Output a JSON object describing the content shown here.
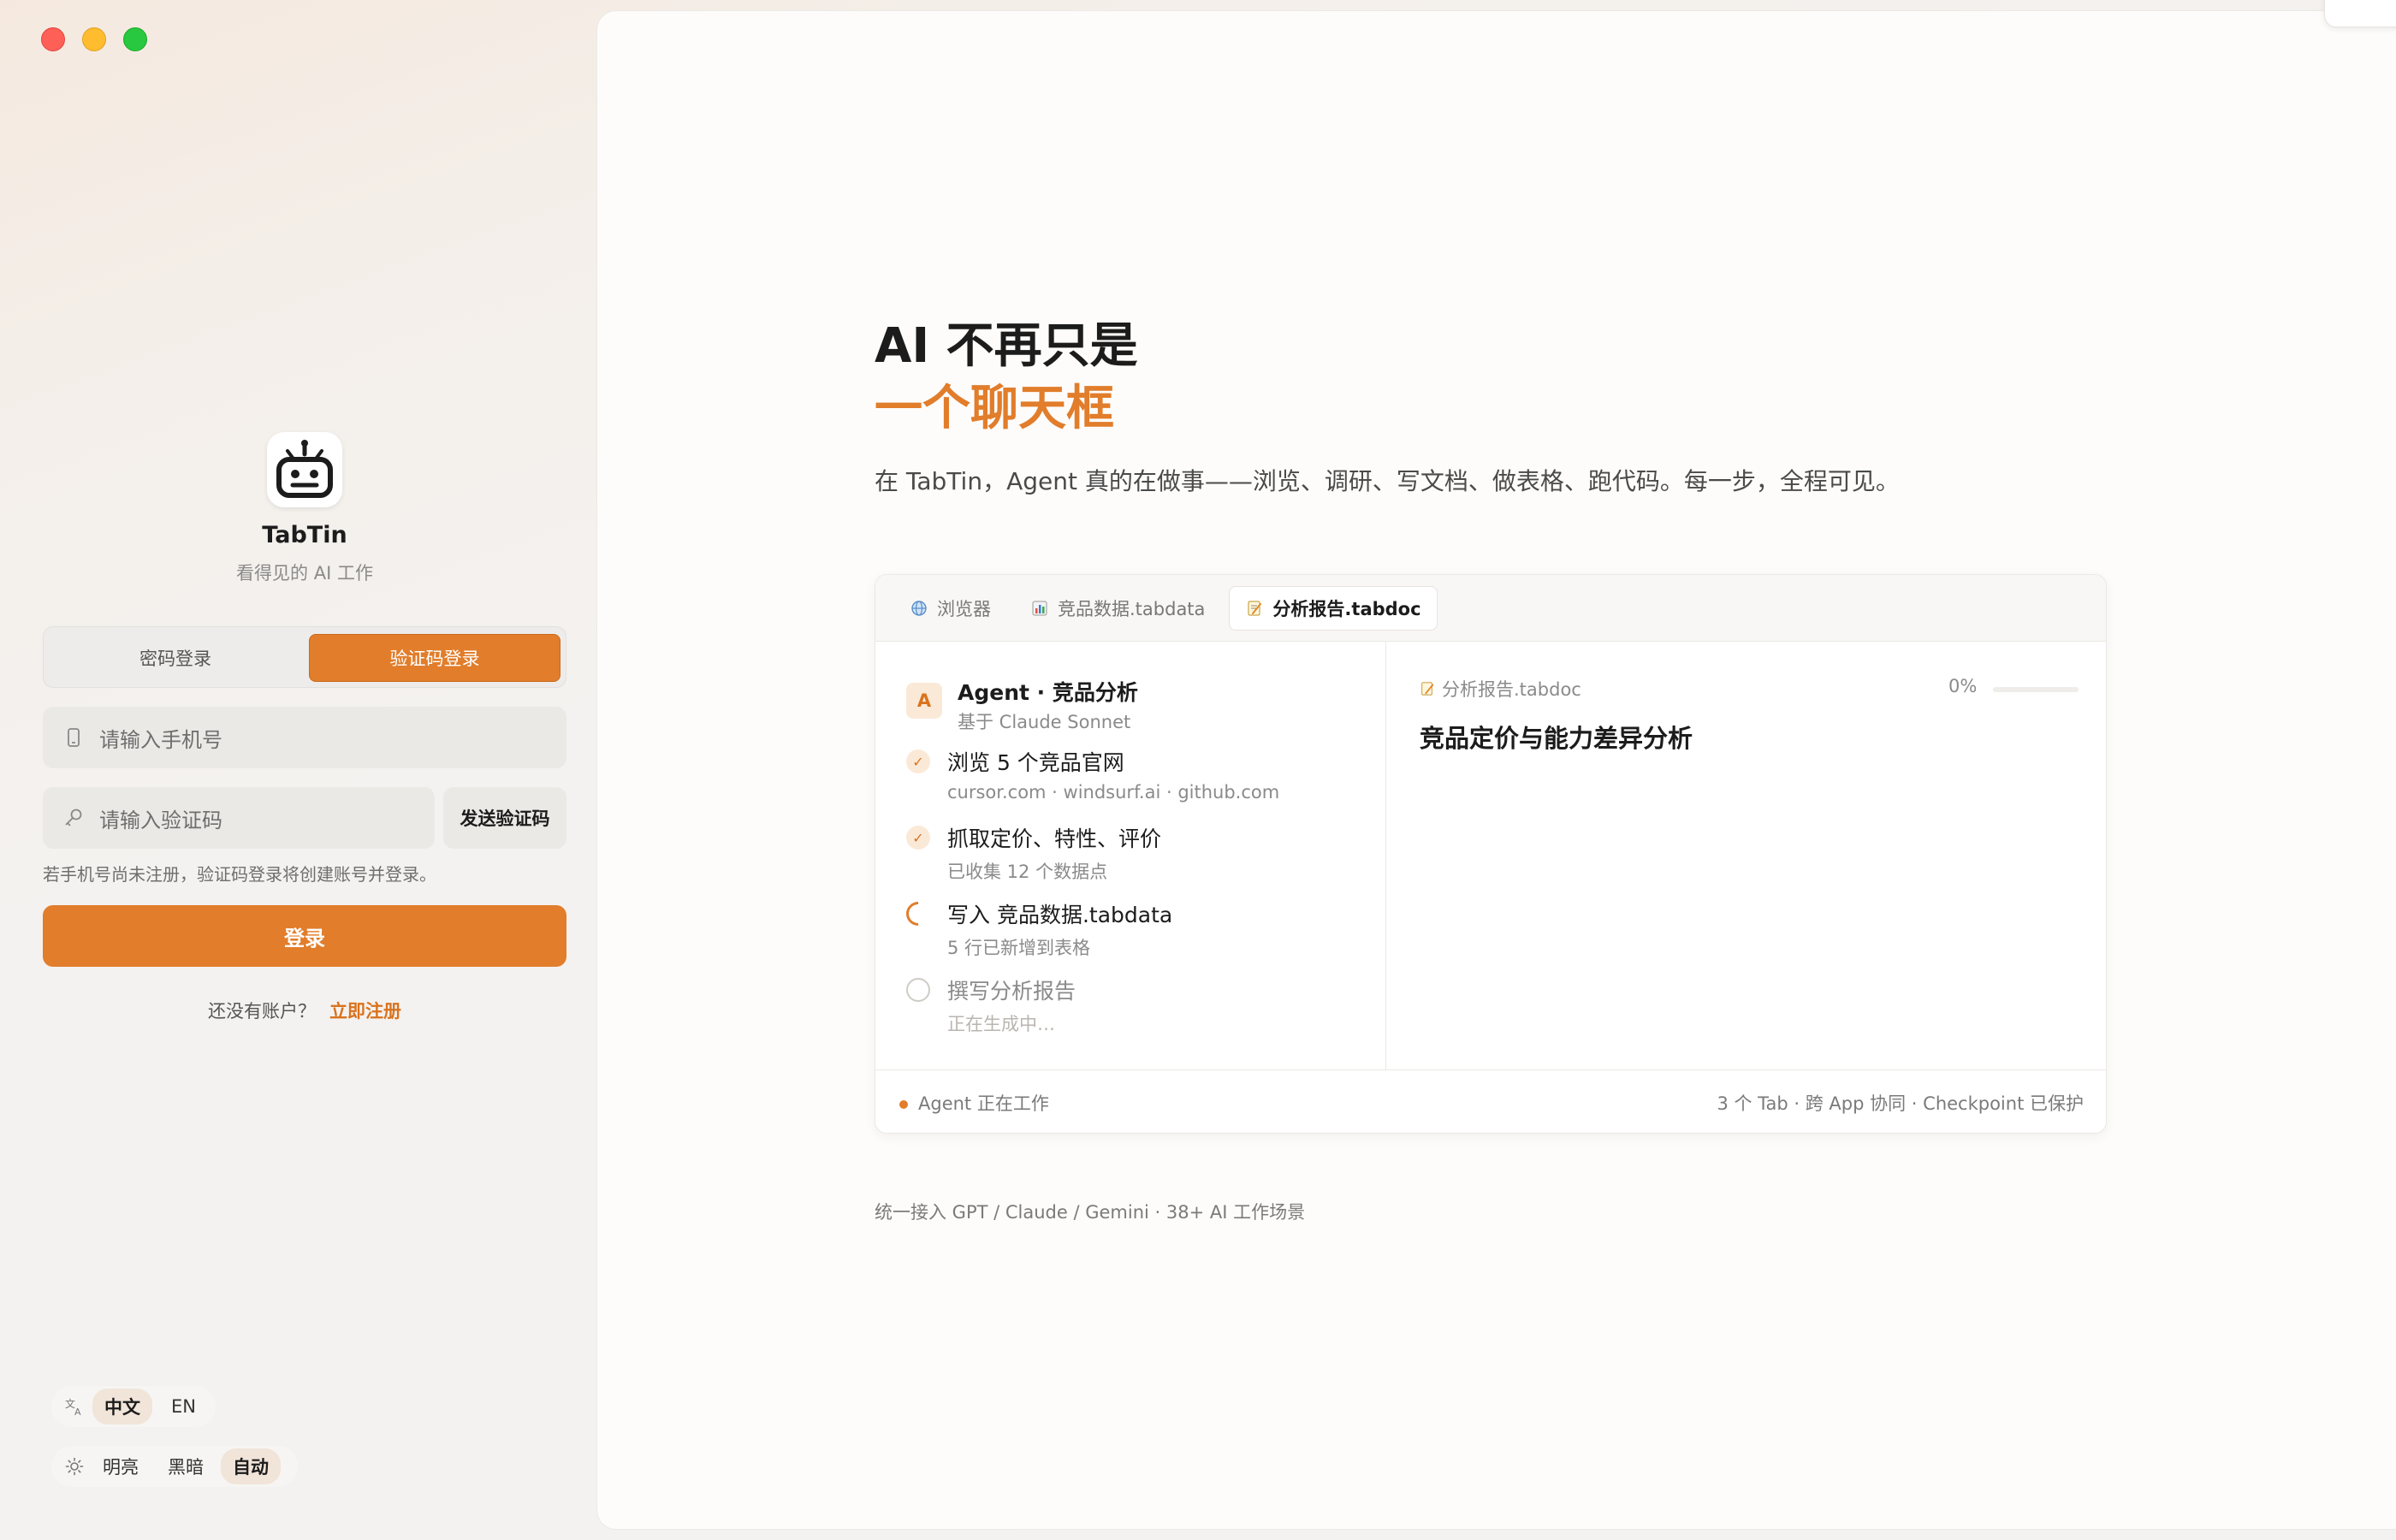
{
  "app": {
    "name": "TabTin",
    "tagline": "看得见的 AI 工作"
  },
  "login": {
    "tabs": {
      "password": "密码登录",
      "code": "验证码登录"
    },
    "phone_placeholder": "请输入手机号",
    "code_placeholder": "请输入验证码",
    "send_code": "发送验证码",
    "hint": "若手机号尚未注册，验证码登录将创建账号并登录。",
    "submit": "登录",
    "no_account": "还没有账户？",
    "register": "立即注册"
  },
  "settings": {
    "languages": [
      "中文",
      "EN"
    ],
    "themes": [
      "明亮",
      "黑暗",
      "自动"
    ]
  },
  "hero": {
    "title_line1": "AI 不再只是",
    "title_line2": "一个聊天框",
    "subtitle": "在 TabTin，Agent 真的在做事——浏览、调研、写文档、做表格、跑代码。每一步，全程可见。"
  },
  "demo": {
    "tabs": [
      {
        "icon": "globe-icon",
        "label": "浏览器"
      },
      {
        "icon": "bar-chart-icon",
        "label": "竞品数据.tabdata"
      },
      {
        "icon": "memo-icon",
        "label": "分析报告.tabdoc"
      }
    ],
    "agent": {
      "avatar": "A",
      "title": "Agent · 竞品分析",
      "subtitle": "基于 Claude Sonnet"
    },
    "steps": [
      {
        "status": "done",
        "title": "浏览 5 个竞品官网",
        "detail": "cursor.com · windsurf.ai · github.com"
      },
      {
        "status": "done",
        "title": "抓取定价、特性、评价",
        "detail": "已收集 12 个数据点"
      },
      {
        "status": "running",
        "title": "写入 竞品数据.tabdata",
        "detail": "5 行已新增到表格"
      },
      {
        "status": "pending",
        "title": "撰写分析报告",
        "detail": "正在生成中…"
      }
    ],
    "document": {
      "file": "分析报告.tabdoc",
      "progress_label": "0%",
      "progress": 0,
      "title": "竞品定价与能力差异分析"
    },
    "footer": {
      "status": "Agent 正在工作",
      "info": "3 个 Tab · 跨 App 协同 · Checkpoint 已保护"
    }
  },
  "support_line": "统一接入 GPT / Claude / Gemini · 38+ AI 工作场景",
  "colors": {
    "accent": "#e17d2b",
    "text": "#1c1c1c",
    "muted": "#8a8a8a"
  }
}
